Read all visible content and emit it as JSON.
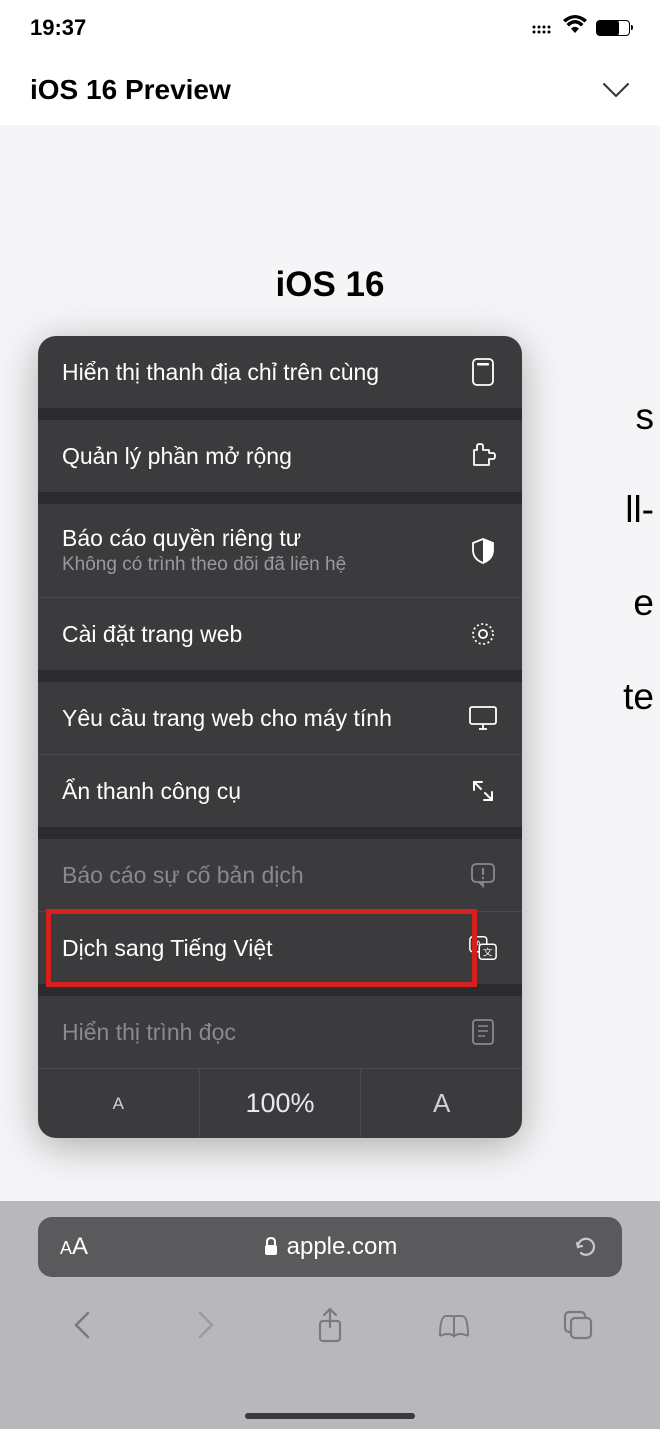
{
  "status_bar": {
    "time": "19:37"
  },
  "nav_header": {
    "title": "iOS 16 Preview"
  },
  "page": {
    "heading": "iOS 16"
  },
  "background_text": {
    "line1": "s",
    "line2": "ll-",
    "line3": "e",
    "line4": "te"
  },
  "menu": {
    "items": [
      {
        "label": "Hiển thị thanh địa chỉ trên cùng",
        "icon": "address-top"
      },
      {
        "label": "Quản lý phần mở rộng",
        "icon": "extension"
      },
      {
        "label": "Báo cáo quyền riêng tư",
        "sublabel": "Không có trình theo dõi đã liên hệ",
        "icon": "shield"
      },
      {
        "label": "Cài đặt trang web",
        "icon": "gear"
      },
      {
        "label": "Yêu cầu trang web cho máy tính",
        "icon": "monitor"
      },
      {
        "label": "Ẩn thanh công cụ",
        "icon": "expand"
      },
      {
        "label": "Báo cáo sự cố bản dịch",
        "icon": "report",
        "disabled": true
      },
      {
        "label": "Dịch sang Tiếng Việt",
        "icon": "translate",
        "highlighted": true
      },
      {
        "label": "Hiển thị trình đọc",
        "icon": "reader",
        "disabled": true
      }
    ],
    "zoom": {
      "small": "A",
      "percent": "100%",
      "large": "A"
    }
  },
  "toolbar": {
    "url": "apple.com"
  }
}
